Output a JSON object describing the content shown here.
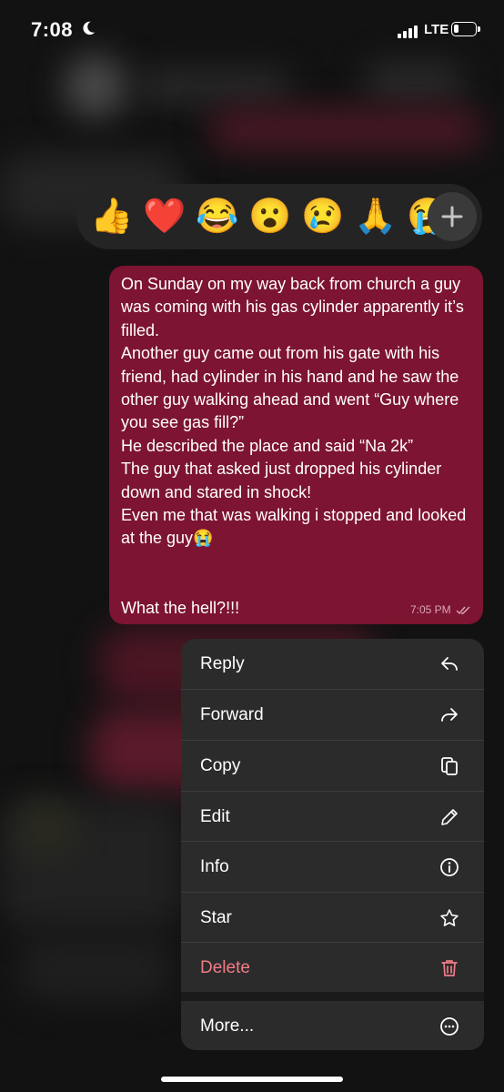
{
  "status_bar": {
    "time": "7:08",
    "network": "LTE"
  },
  "reactions": [
    "👍",
    "❤️",
    "😂",
    "😮",
    "😢",
    "🙏",
    "😭"
  ],
  "message": {
    "text": "On Sunday on my way back from church a guy was coming with his gas cylinder apparently it’s filled.\nAnother guy came out from his gate with his friend, had cylinder in his hand and he saw the other guy walking ahead and went “Guy where you see gas fill?”\nHe described the place and said “Na 2k”\nThe guy that asked just dropped his cylinder down and stared in shock!\nEven me that was walking i stopped and looked at the guy😭\n\n\nWhat the hell?!!!",
    "time": "7:05 PM"
  },
  "menu": {
    "items": [
      {
        "label": "Reply",
        "icon": "reply-icon"
      },
      {
        "label": "Forward",
        "icon": "forward-icon"
      },
      {
        "label": "Copy",
        "icon": "copy-icon"
      },
      {
        "label": "Edit",
        "icon": "pencil-icon"
      },
      {
        "label": "Info",
        "icon": "info-icon"
      },
      {
        "label": "Star",
        "icon": "star-icon"
      },
      {
        "label": "Delete",
        "icon": "trash-icon"
      }
    ],
    "more_label": "More..."
  },
  "colors": {
    "bubble": "#7d1431",
    "delete": "#f07c86",
    "menu_bg": "#2b2b2b"
  }
}
